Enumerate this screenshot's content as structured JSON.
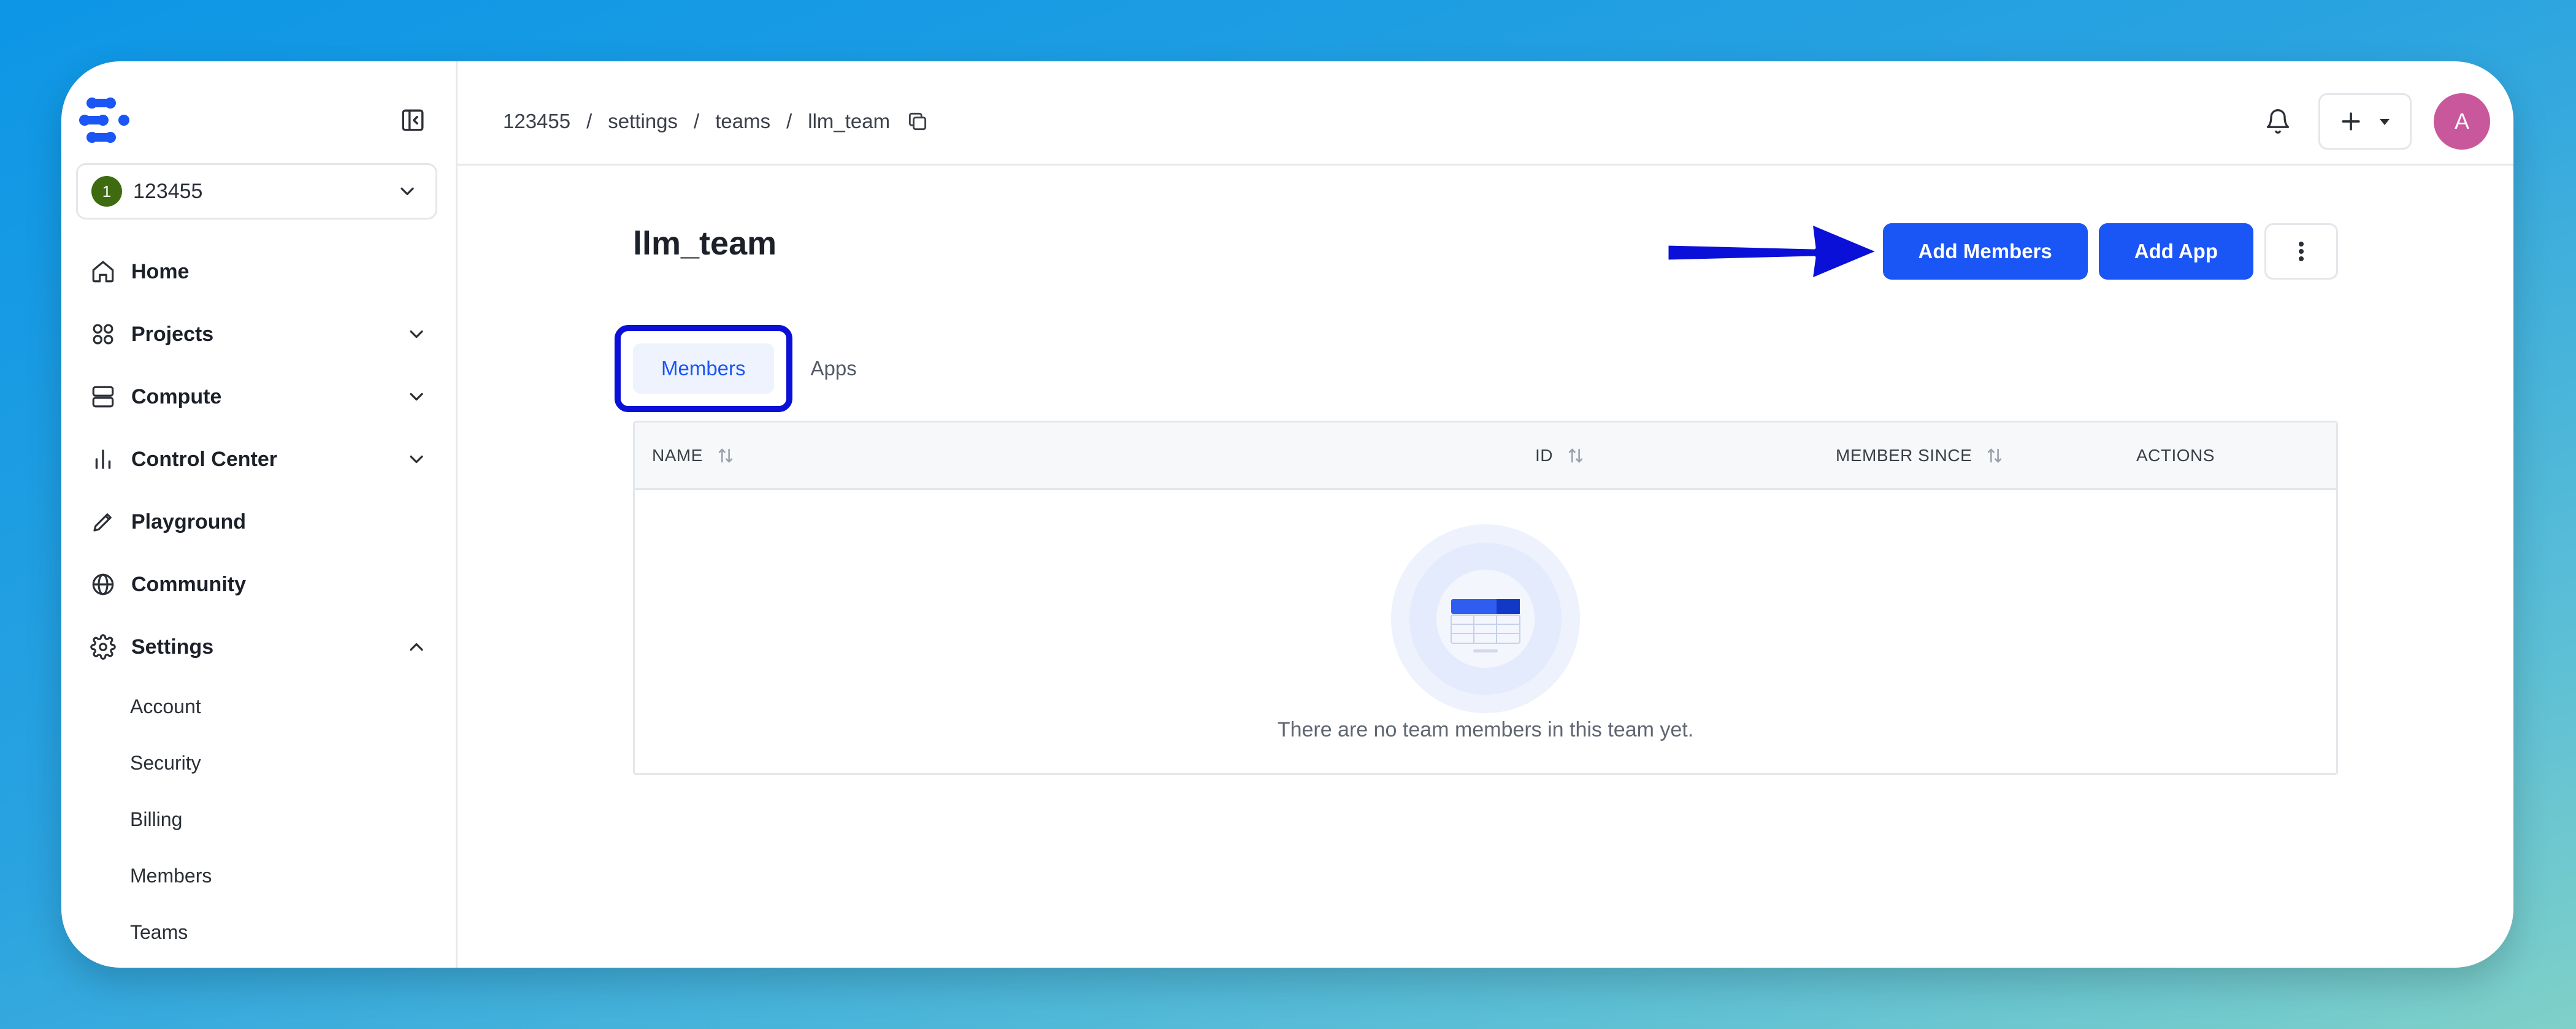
{
  "org": {
    "badge": "1",
    "name": "123455"
  },
  "nav": {
    "items": [
      {
        "label": "Home",
        "icon": "home-icon",
        "expandable": false
      },
      {
        "label": "Projects",
        "icon": "grid-icon",
        "expandable": true
      },
      {
        "label": "Compute",
        "icon": "server-icon",
        "expandable": true
      },
      {
        "label": "Control Center",
        "icon": "bar-chart-icon",
        "expandable": true
      },
      {
        "label": "Playground",
        "icon": "pencil-icon",
        "expandable": false
      },
      {
        "label": "Community",
        "icon": "globe-icon",
        "expandable": false
      },
      {
        "label": "Settings",
        "icon": "gear-icon",
        "expandable": true,
        "expanded": true
      }
    ],
    "settings_sub": [
      "Account",
      "Security",
      "Billing",
      "Members",
      "Teams"
    ]
  },
  "breadcrumb": [
    "123455",
    "settings",
    "teams",
    "llm_team"
  ],
  "breadcrumb_separator": "/",
  "user": {
    "initial": "A",
    "avatar_color": "#c9579b"
  },
  "page": {
    "title": "llm_team",
    "add_members_label": "Add Members",
    "add_app_label": "Add App"
  },
  "tabs": [
    {
      "label": "Members",
      "active": true
    },
    {
      "label": "Apps",
      "active": false
    }
  ],
  "table": {
    "columns": [
      {
        "label": "NAME",
        "sortable": true
      },
      {
        "label": "ID",
        "sortable": true
      },
      {
        "label": "MEMBER SINCE",
        "sortable": true
      },
      {
        "label": "ACTIONS",
        "sortable": false
      }
    ],
    "empty_message": "There are no team members in this team yet."
  },
  "colors": {
    "accent": "#1a55f5",
    "annotation": "#0b10d8",
    "org_badge": "#3e6b10"
  }
}
